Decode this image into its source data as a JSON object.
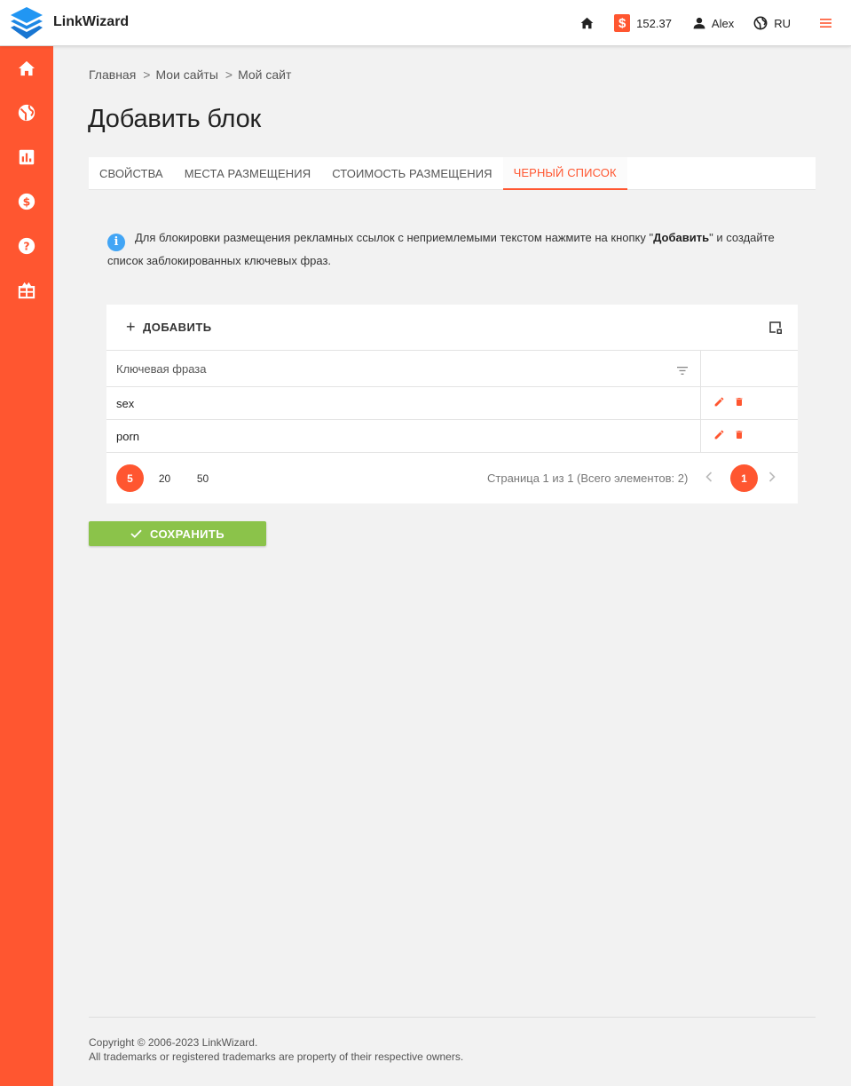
{
  "app": {
    "brand": "LinkWizard",
    "balance": "152.37",
    "balance_symbol": "$",
    "user": "Alex",
    "language": "RU"
  },
  "icons": {
    "top": [
      "logo-layers-icon",
      "home-icon",
      "dollar-icon",
      "user-icon",
      "globe-icon",
      "hamburger-menu-icon"
    ],
    "sidebar": [
      "home-icon",
      "globe-icon",
      "bar-chart-icon",
      "dollar-circle-icon",
      "help-icon",
      "gift-icon"
    ],
    "table": [
      "plus-icon",
      "table-settings-icon",
      "filter-icon",
      "pencil-icon",
      "trash-icon",
      "chevron-left-icon",
      "chevron-right-icon"
    ],
    "save": "check-icon",
    "info": "info-icon"
  },
  "colors": {
    "accent": "#ff5630",
    "save": "#8bc34a",
    "info": "#42a5f5"
  },
  "breadcrumb": [
    "Главная",
    "Мои сайты",
    "Мой сайт"
  ],
  "breadcrumb_sep": ">",
  "page_title": "Добавить блок",
  "tabs": [
    {
      "label": "Свойства",
      "active": false
    },
    {
      "label": "Места размещения",
      "active": false
    },
    {
      "label": "Стоимость размещения",
      "active": false
    },
    {
      "label": "Черный список",
      "active": true
    }
  ],
  "info": {
    "icon_glyph": "i",
    "text_before": "Для блокировки размещения рекламных ссылок с неприемлемыми текстом нажмите на кнопку ",
    "quote_open": "\"",
    "bold": "Добавить",
    "quote_close": "\"",
    "text_after": " и создайте список заблокированных ключевых фраз."
  },
  "table": {
    "add_label": "ДОБАВИТЬ",
    "column_header": "Ключевая фраза",
    "rows": [
      "sex",
      "porn"
    ],
    "page_sizes": [
      "5",
      "20",
      "50"
    ],
    "active_page_size": "5",
    "page_info": "Страница 1 из 1 (Всего элементов: 2)",
    "current_page": "1"
  },
  "save_label": "СОХРАНИТЬ",
  "footer": {
    "copyright": "Copyright © 2006-2023 LinkWizard.",
    "trademarks": "All trademarks or registered trademarks are property of their respective owners."
  }
}
